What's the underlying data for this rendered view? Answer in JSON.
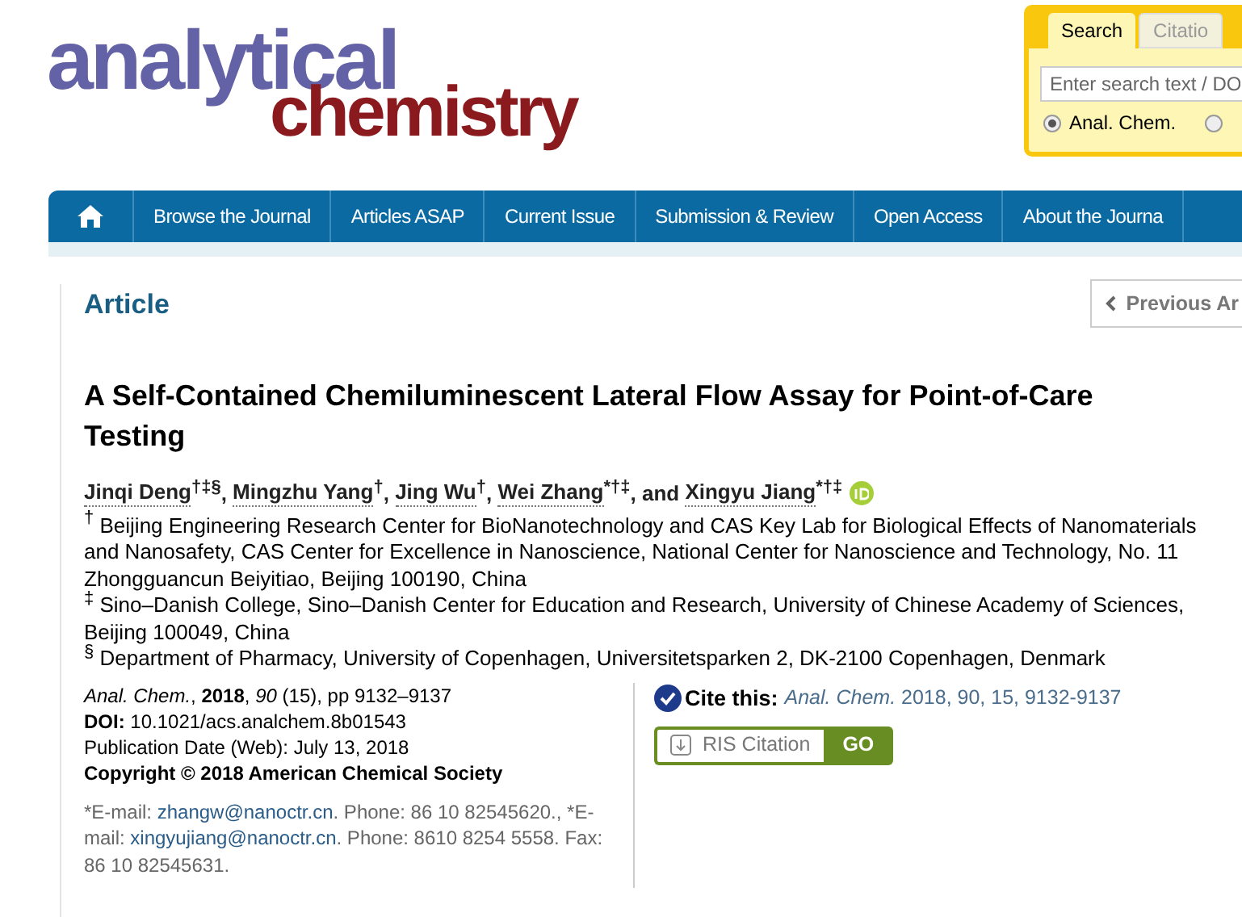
{
  "logo": {
    "line_1": "analytical",
    "line_2": "chemistry"
  },
  "search_widget": {
    "tabs": [
      {
        "label": "Search",
        "selected": true
      },
      {
        "label": "Citatio",
        "selected": false
      }
    ],
    "placeholder": "Enter search text / DO",
    "options": [
      {
        "label": "Anal. Chem.",
        "selected": true
      },
      {
        "selected": false
      }
    ]
  },
  "nav": [
    {
      "kind": "home"
    },
    {
      "kind": "link",
      "label": "Browse the Journal"
    },
    {
      "kind": "link",
      "label": "Articles ASAP"
    },
    {
      "kind": "link",
      "label": "Current Issue"
    },
    {
      "kind": "link",
      "label": "Submission & Review"
    },
    {
      "kind": "link",
      "label": "Open Access"
    },
    {
      "kind": "link",
      "label": "About the Journa"
    }
  ],
  "section_label": "Article",
  "previous_button": "Previous Ar",
  "title": "A Self-Contained Chemiluminescent Lateral Flow Assay for Point-of-Care Testing",
  "authors": [
    {
      "name": "Jinqi Deng",
      "marks": "†‡§",
      "after": ", ",
      "orcid": false
    },
    {
      "name": "Mingzhu Yang",
      "marks": "†",
      "after": ", ",
      "orcid": false
    },
    {
      "name": "Jing Wu",
      "marks": "†",
      "after": ", ",
      "orcid": false
    },
    {
      "name": "Wei Zhang",
      "marks": "*†‡",
      "after": ", and ",
      "orcid": false
    },
    {
      "name": "Xingyu Jiang",
      "marks": "*†‡",
      "orcid": true
    }
  ],
  "affiliations": [
    {
      "mark": "†",
      "text": "Beijing Engineering Research Center for BioNanotechnology and CAS Key Lab for Biological Effects of Nanomaterials and Nanosafety, CAS Center for Excellence in Nanoscience, National Center for Nanoscience and Technology, No. 11 Zhongguancun Beiyitiao, Beijing 100190, China"
    },
    {
      "mark": "‡",
      "text": "Sino–Danish College, Sino–Danish Center for Education and Research, University of Chinese Academy of Sciences, Beijing 100049, China"
    },
    {
      "mark": "§",
      "text": "Department of Pharmacy, University of Copenhagen, Universitetsparken 2, DK-2100 Copenhagen, Denmark"
    }
  ],
  "publication": [
    "*Anal. Chem.*, **2018**, *90* (15), pp 9132–9137",
    "**DOI:** 10.1021/acs.analchem.8b01543",
    "Publication Date (Web): July 13, 2018"
  ],
  "copyright": "Copyright © 2018 American Chemical Society",
  "contact": [
    {
      "kind": "text",
      "text": "*E-mail: "
    },
    {
      "kind": "link",
      "text": "zhangw@nanoctr.cn"
    },
    {
      "kind": "text",
      "text": ". Phone: 86 10 82545620., *E-mail: "
    },
    {
      "kind": "link",
      "text": "xingyujiang@nanoctr.cn"
    },
    {
      "kind": "text",
      "text": ". Phone: 8610 8254 5558. Fax: 86 10 82545631."
    }
  ],
  "cite": {
    "label": "Cite this:",
    "citation": "*Anal. Chem.* 2018, 90, 15, 9132-9137"
  },
  "ris_button": "RIS Citation",
  "go_button": "GO"
}
